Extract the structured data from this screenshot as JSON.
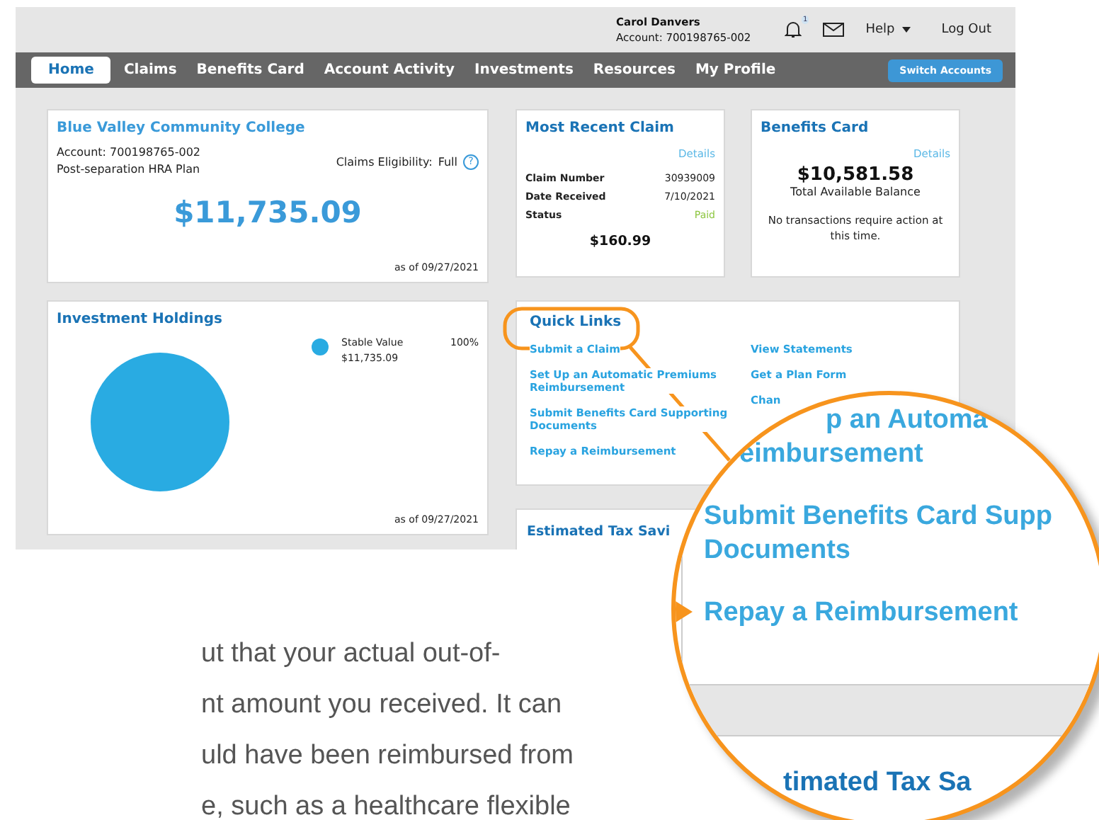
{
  "header": {
    "user_name": "Carol Danvers",
    "account": "Account: 700198765-002",
    "notification_count": "1",
    "help": "Help",
    "logout": "Log Out"
  },
  "nav": {
    "tabs": [
      {
        "label": "Home",
        "selected": true
      },
      {
        "label": "Claims",
        "selected": false
      },
      {
        "label": "Benefits Card",
        "selected": false
      },
      {
        "label": "Account Activity",
        "selected": false
      },
      {
        "label": "Investments",
        "selected": false
      },
      {
        "label": "Resources",
        "selected": false
      },
      {
        "label": "My Profile",
        "selected": false
      }
    ],
    "switch_button": "Switch Accounts"
  },
  "account_card": {
    "title": "Blue Valley Community College",
    "account": "Account:  700198765-002",
    "plan": "Post-separation HRA Plan",
    "eligibility_label": "Claims Eligibility:",
    "eligibility_value": "Full",
    "help_glyph": "?",
    "balance": "$11,735.09",
    "as_of": "as of 09/27/2021"
  },
  "claim_card": {
    "title": "Most Recent Claim",
    "details_link": "Details",
    "rows": [
      {
        "label": "Claim Number",
        "value": "30939009",
        "kind": "plain"
      },
      {
        "label": "Date Received",
        "value": "7/10/2021",
        "kind": "plain"
      },
      {
        "label": "Status",
        "value": "Paid",
        "kind": "status"
      }
    ],
    "amount": "$160.99"
  },
  "benefits_card": {
    "title": "Benefits Card",
    "details_link": "Details",
    "balance": "$10,581.58",
    "balance_label": "Total Available Balance",
    "message": "No transactions require action at this time."
  },
  "investments_card": {
    "title": "Investment Holdings",
    "legend": [
      {
        "name": "Stable Value",
        "percent": "100%",
        "amount": "$11,735.09",
        "color": "#29abe2"
      }
    ],
    "as_of": "as of 09/27/2021"
  },
  "quick_links": {
    "title": "Quick Links",
    "highlighted": true,
    "columns": [
      [
        "Submit a Claim",
        "Set Up an Automatic Premiums Reimbursement",
        "Submit Benefits Card Supporting Documents",
        "Repay a Reimbursement"
      ],
      [
        "View Statements",
        "Get a Plan Form",
        "Chan"
      ]
    ]
  },
  "tax_card": {
    "title": "Estimated Tax Savi"
  },
  "article": {
    "lines": [
      "ut that your actual out-of-",
      "nt amount you received. It can",
      "uld have been reimbursed from",
      "e, such as a healthcare flexible"
    ]
  },
  "magnifier": {
    "links": [
      {
        "lines": [
          "p an Automa",
          "eimbursement"
        ],
        "pointer": false
      },
      {
        "lines": [
          "Submit Benefits Card Supp",
          "Documents"
        ],
        "pointer": false
      },
      {
        "lines": [
          "Repay a Reimbursement"
        ],
        "pointer": true
      }
    ],
    "next_card_title": "timated Tax Sa"
  }
}
